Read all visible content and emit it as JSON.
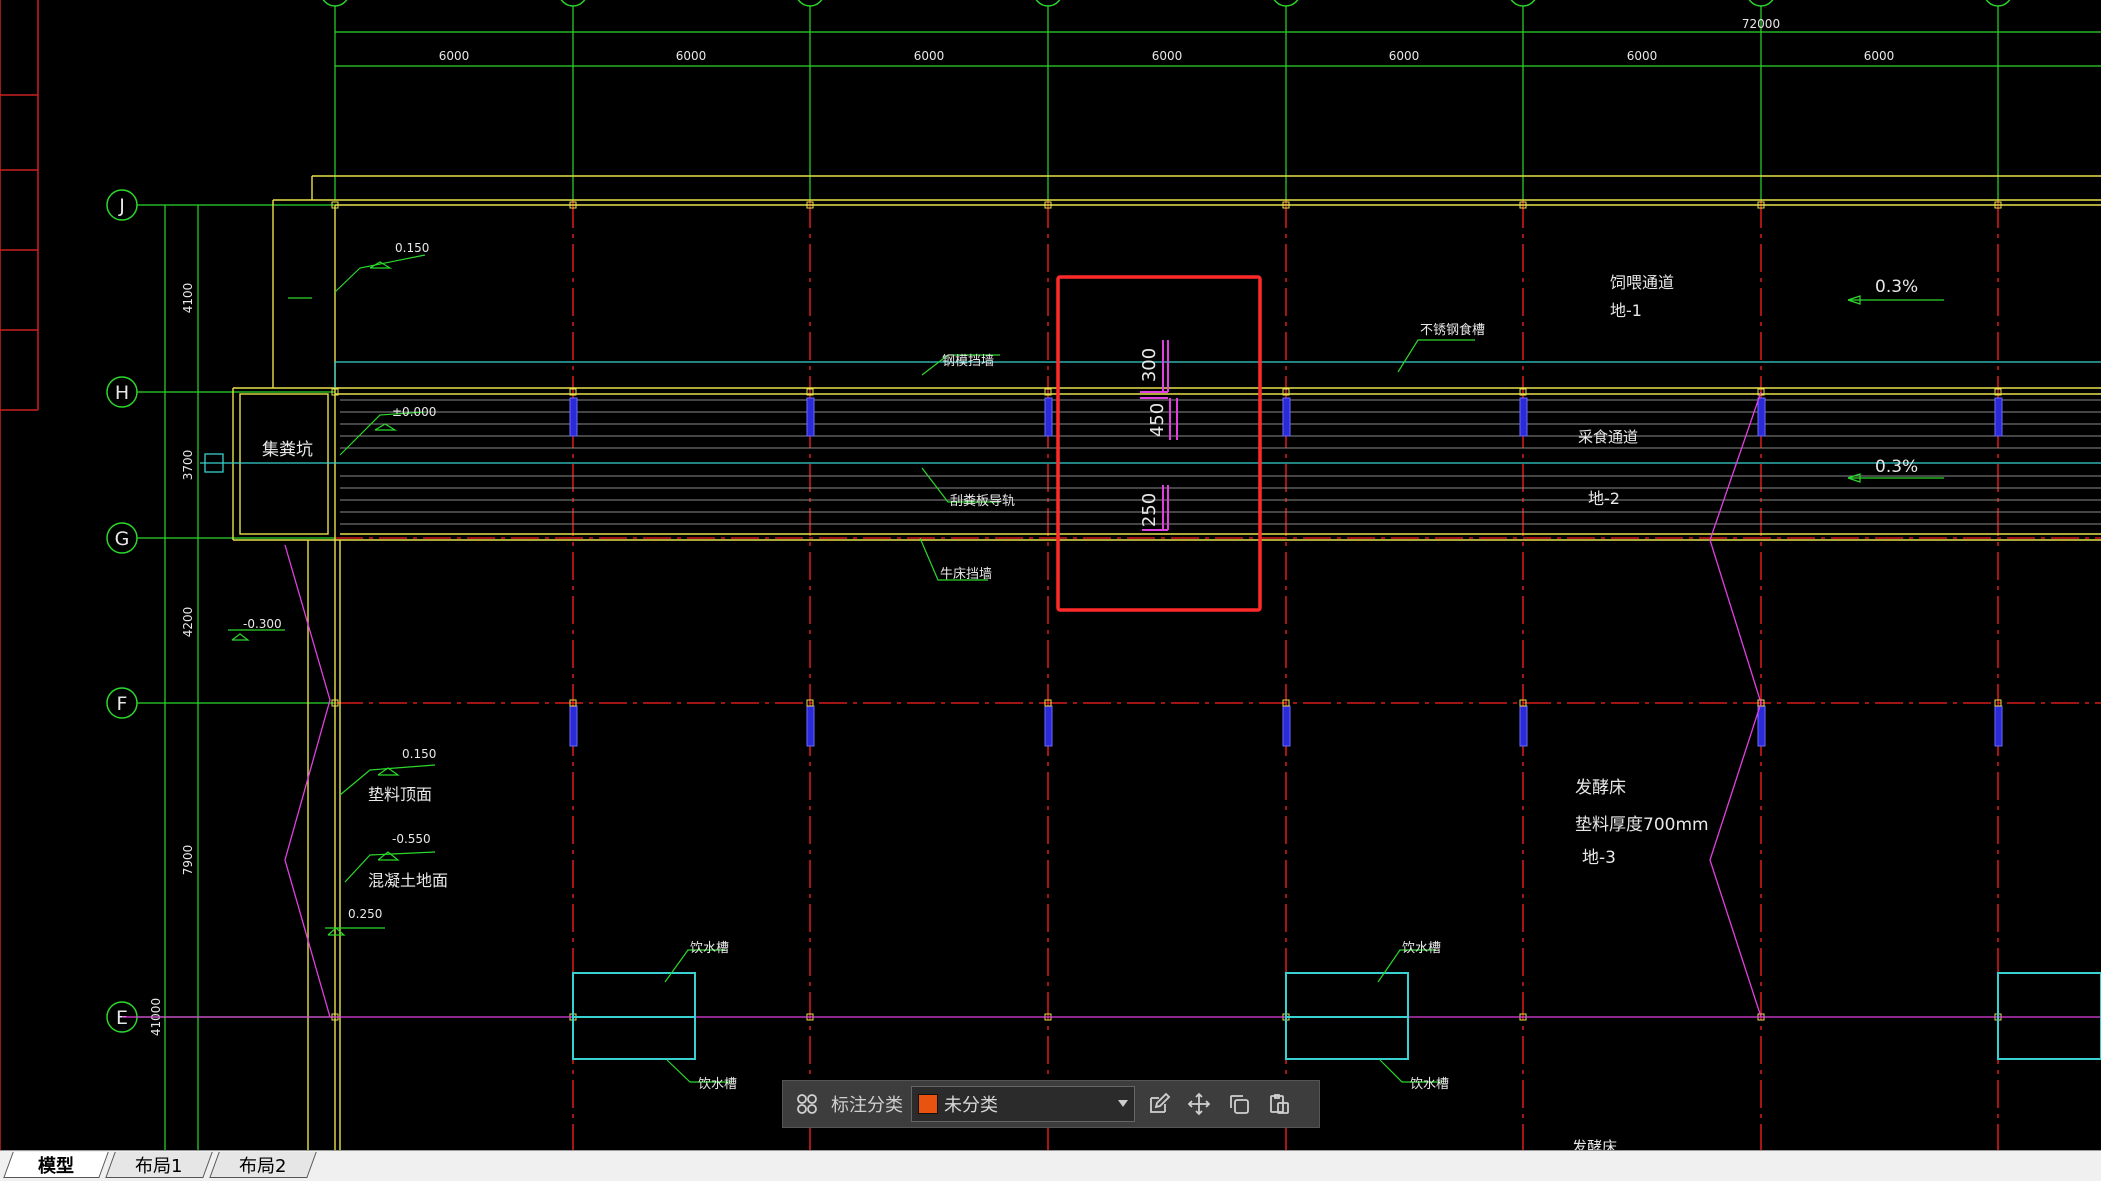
{
  "drawing": {
    "axis_top": [
      "",
      "",
      "",
      "",
      "",
      "",
      "",
      ""
    ],
    "axis_left": [
      "J",
      "H",
      "G",
      "F",
      "E"
    ],
    "dims_top": [
      "6000",
      "6000",
      "6000",
      "6000",
      "6000",
      "6000",
      "6000"
    ],
    "dim_total": "72000",
    "dims_left": [
      "4100",
      "3700",
      "4200",
      "7900",
      "41000"
    ],
    "labels": {
      "elev_0150_a": "0.150",
      "elev_0000": "±0.000",
      "elev_m0300": "-0.300",
      "elev_0150_b": "0.150",
      "elev_m0550": "-0.550",
      "elev_0250": "0.250",
      "collection_pit": "集粪坑",
      "steel_wall": "钢模挡墙",
      "stainless_trough": "不锈钢食槽",
      "feed_aisle_title": "饲喂通道",
      "feed_aisle_code": "地-1",
      "slope_top": "0.3%",
      "dung_aisle_title": "采食通道",
      "dung_aisle_code": "地-2",
      "slope_mid": "0.3%",
      "scraper_rail": "刮粪板导轨",
      "cow_bed_wall": "牛床挡墙",
      "fermentation_bed": "发酵床",
      "bedding_thickness": "垫料厚度700mm",
      "bed_code": "地-3",
      "bedding_surface": "垫料顶面",
      "concrete_floor": "混凝土地面",
      "water_trough_1": "饮水槽",
      "water_trough_2": "饮水槽",
      "water_trough_3": "饮水槽",
      "water_trough_4": "饮水槽",
      "fermentation_bed_2": "发酵床",
      "detail_300": "300",
      "detail_450": "450",
      "detail_250": "250"
    }
  },
  "toolbar": {
    "label": "标注分类",
    "selected": "未分类",
    "swatch_color": "#e8530f"
  },
  "tabs": [
    {
      "label": "模型",
      "active": true
    },
    {
      "label": "布局1",
      "active": false
    },
    {
      "label": "布局2",
      "active": false
    }
  ],
  "colors": {
    "grid_line": "#ff2020",
    "axis_green": "#2bd82b",
    "wall_yellow": "#e8e04a",
    "cyan": "#38d0d0",
    "magenta": "#e040e0",
    "column_blue": "#3a3aff",
    "highlight": "#ff2a2a"
  }
}
